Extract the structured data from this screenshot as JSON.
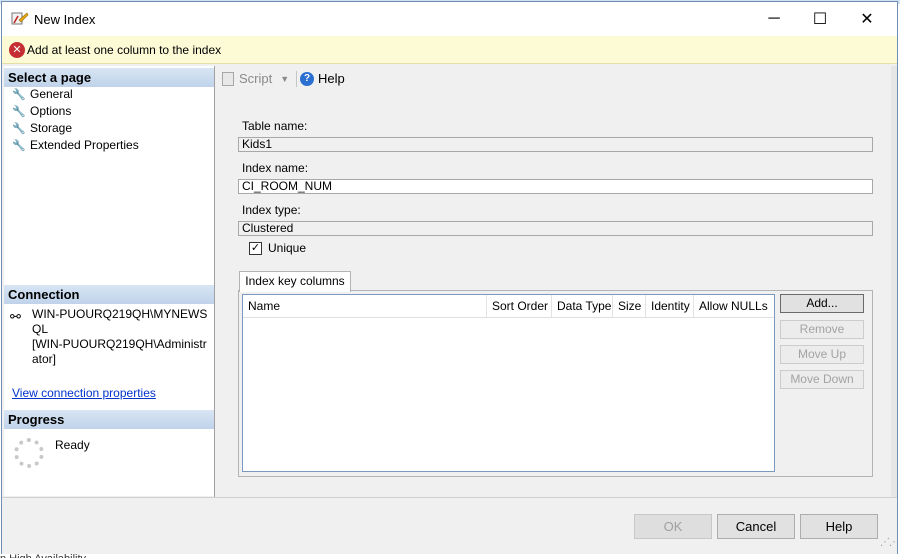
{
  "window": {
    "title": "New Index",
    "minimize_glyph": "─",
    "maximize_glyph": "☐",
    "close_glyph": "✕"
  },
  "message": {
    "text": "Add at least one column to the index",
    "icon": "error-icon",
    "icon_glyph": "✕"
  },
  "select_page": {
    "heading": "Select a page",
    "items": [
      {
        "label": "General",
        "icon": "wrench-icon"
      },
      {
        "label": "Options",
        "icon": "wrench-icon"
      },
      {
        "label": "Storage",
        "icon": "wrench-icon"
      },
      {
        "label": "Extended Properties",
        "icon": "wrench-icon"
      }
    ]
  },
  "connection": {
    "heading": "Connection",
    "server": "WIN-PUOURQ219QH\\MYNEWSQL",
    "user": "[WIN-PUOURQ219QH\\Administrator]",
    "link": "View connection properties"
  },
  "progress": {
    "heading": "Progress",
    "status": "Ready"
  },
  "toolbar": {
    "script": "Script",
    "help": "Help",
    "help_glyph": "?"
  },
  "form": {
    "table_name_label": "Table name:",
    "table_name": "Kids1",
    "index_name_label": "Index name:",
    "index_name": "CI_ROOM_NUM",
    "index_type_label": "Index type:",
    "index_type": "Clustered",
    "unique_label": "Unique",
    "unique_checked": true,
    "unique_mark": "✓"
  },
  "key_columns": {
    "tab": "Index key columns",
    "columns": [
      "Name",
      "Sort Order",
      "Data Type",
      "Size",
      "Identity",
      "Allow NULLs"
    ],
    "rows": [],
    "buttons": [
      {
        "label": "Add...",
        "enabled": true
      },
      {
        "label": "Remove",
        "enabled": false
      },
      {
        "label": "Move Up",
        "enabled": false
      },
      {
        "label": "Move Down",
        "enabled": false
      }
    ]
  },
  "footer": {
    "ok": "OK",
    "cancel": "Cancel",
    "help": "Help",
    "ok_enabled": false
  },
  "background": {
    "peek_text": "n High Availability"
  }
}
